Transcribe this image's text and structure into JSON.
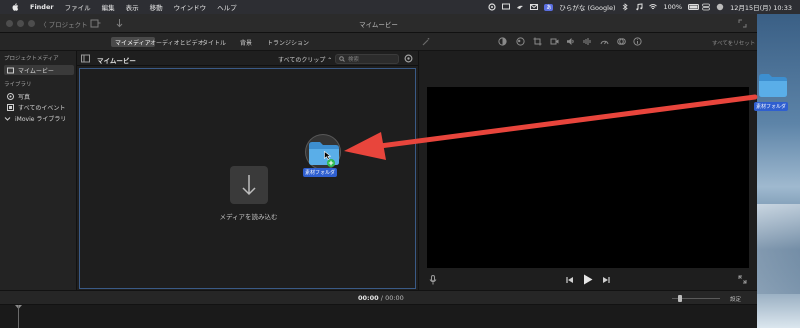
{
  "menubar": {
    "items": [
      "Finder",
      "ファイル",
      "編集",
      "表示",
      "移動",
      "ウインドウ",
      "ヘルプ"
    ],
    "input_method": "ひらがな (Google)",
    "battery": "100%",
    "clock": "12月15日(月) 10:33"
  },
  "window": {
    "title": "マイムービー",
    "back_button": "〈 プロジェクト"
  },
  "tabs": {
    "my_media": "マイメディア",
    "audio_video": "オーディオとビデオ",
    "titles": "タイトル",
    "backgrounds": "背景",
    "transitions": "トランジション",
    "reset_all": "すべてをリセット"
  },
  "sidebar": {
    "project_media_header": "プロジェクトメディア",
    "project_item": "マイムービー",
    "library_header": "ライブラリ",
    "library_items": [
      "写真",
      "すべてのイベント"
    ],
    "imovie_library": "iMovie ライブラリ"
  },
  "browser": {
    "title": "マイムービー",
    "clips_filter": "すべてのクリップ ⌃",
    "search_placeholder": "検索",
    "import_label": "メディアを読み込む"
  },
  "drag": {
    "folder_label": "素材フォルダ"
  },
  "desktop": {
    "folder_label": "素材フォルダ"
  },
  "timeline": {
    "current_time": "00:00",
    "separator": "/",
    "total_time": "00:00",
    "settings_label": "設定"
  },
  "colors": {
    "accent_blue": "#2f5fd0",
    "annotation_red": "#e8453c",
    "folder_blue": "#5aaee8",
    "add_badge_green": "#2dbb4e"
  }
}
